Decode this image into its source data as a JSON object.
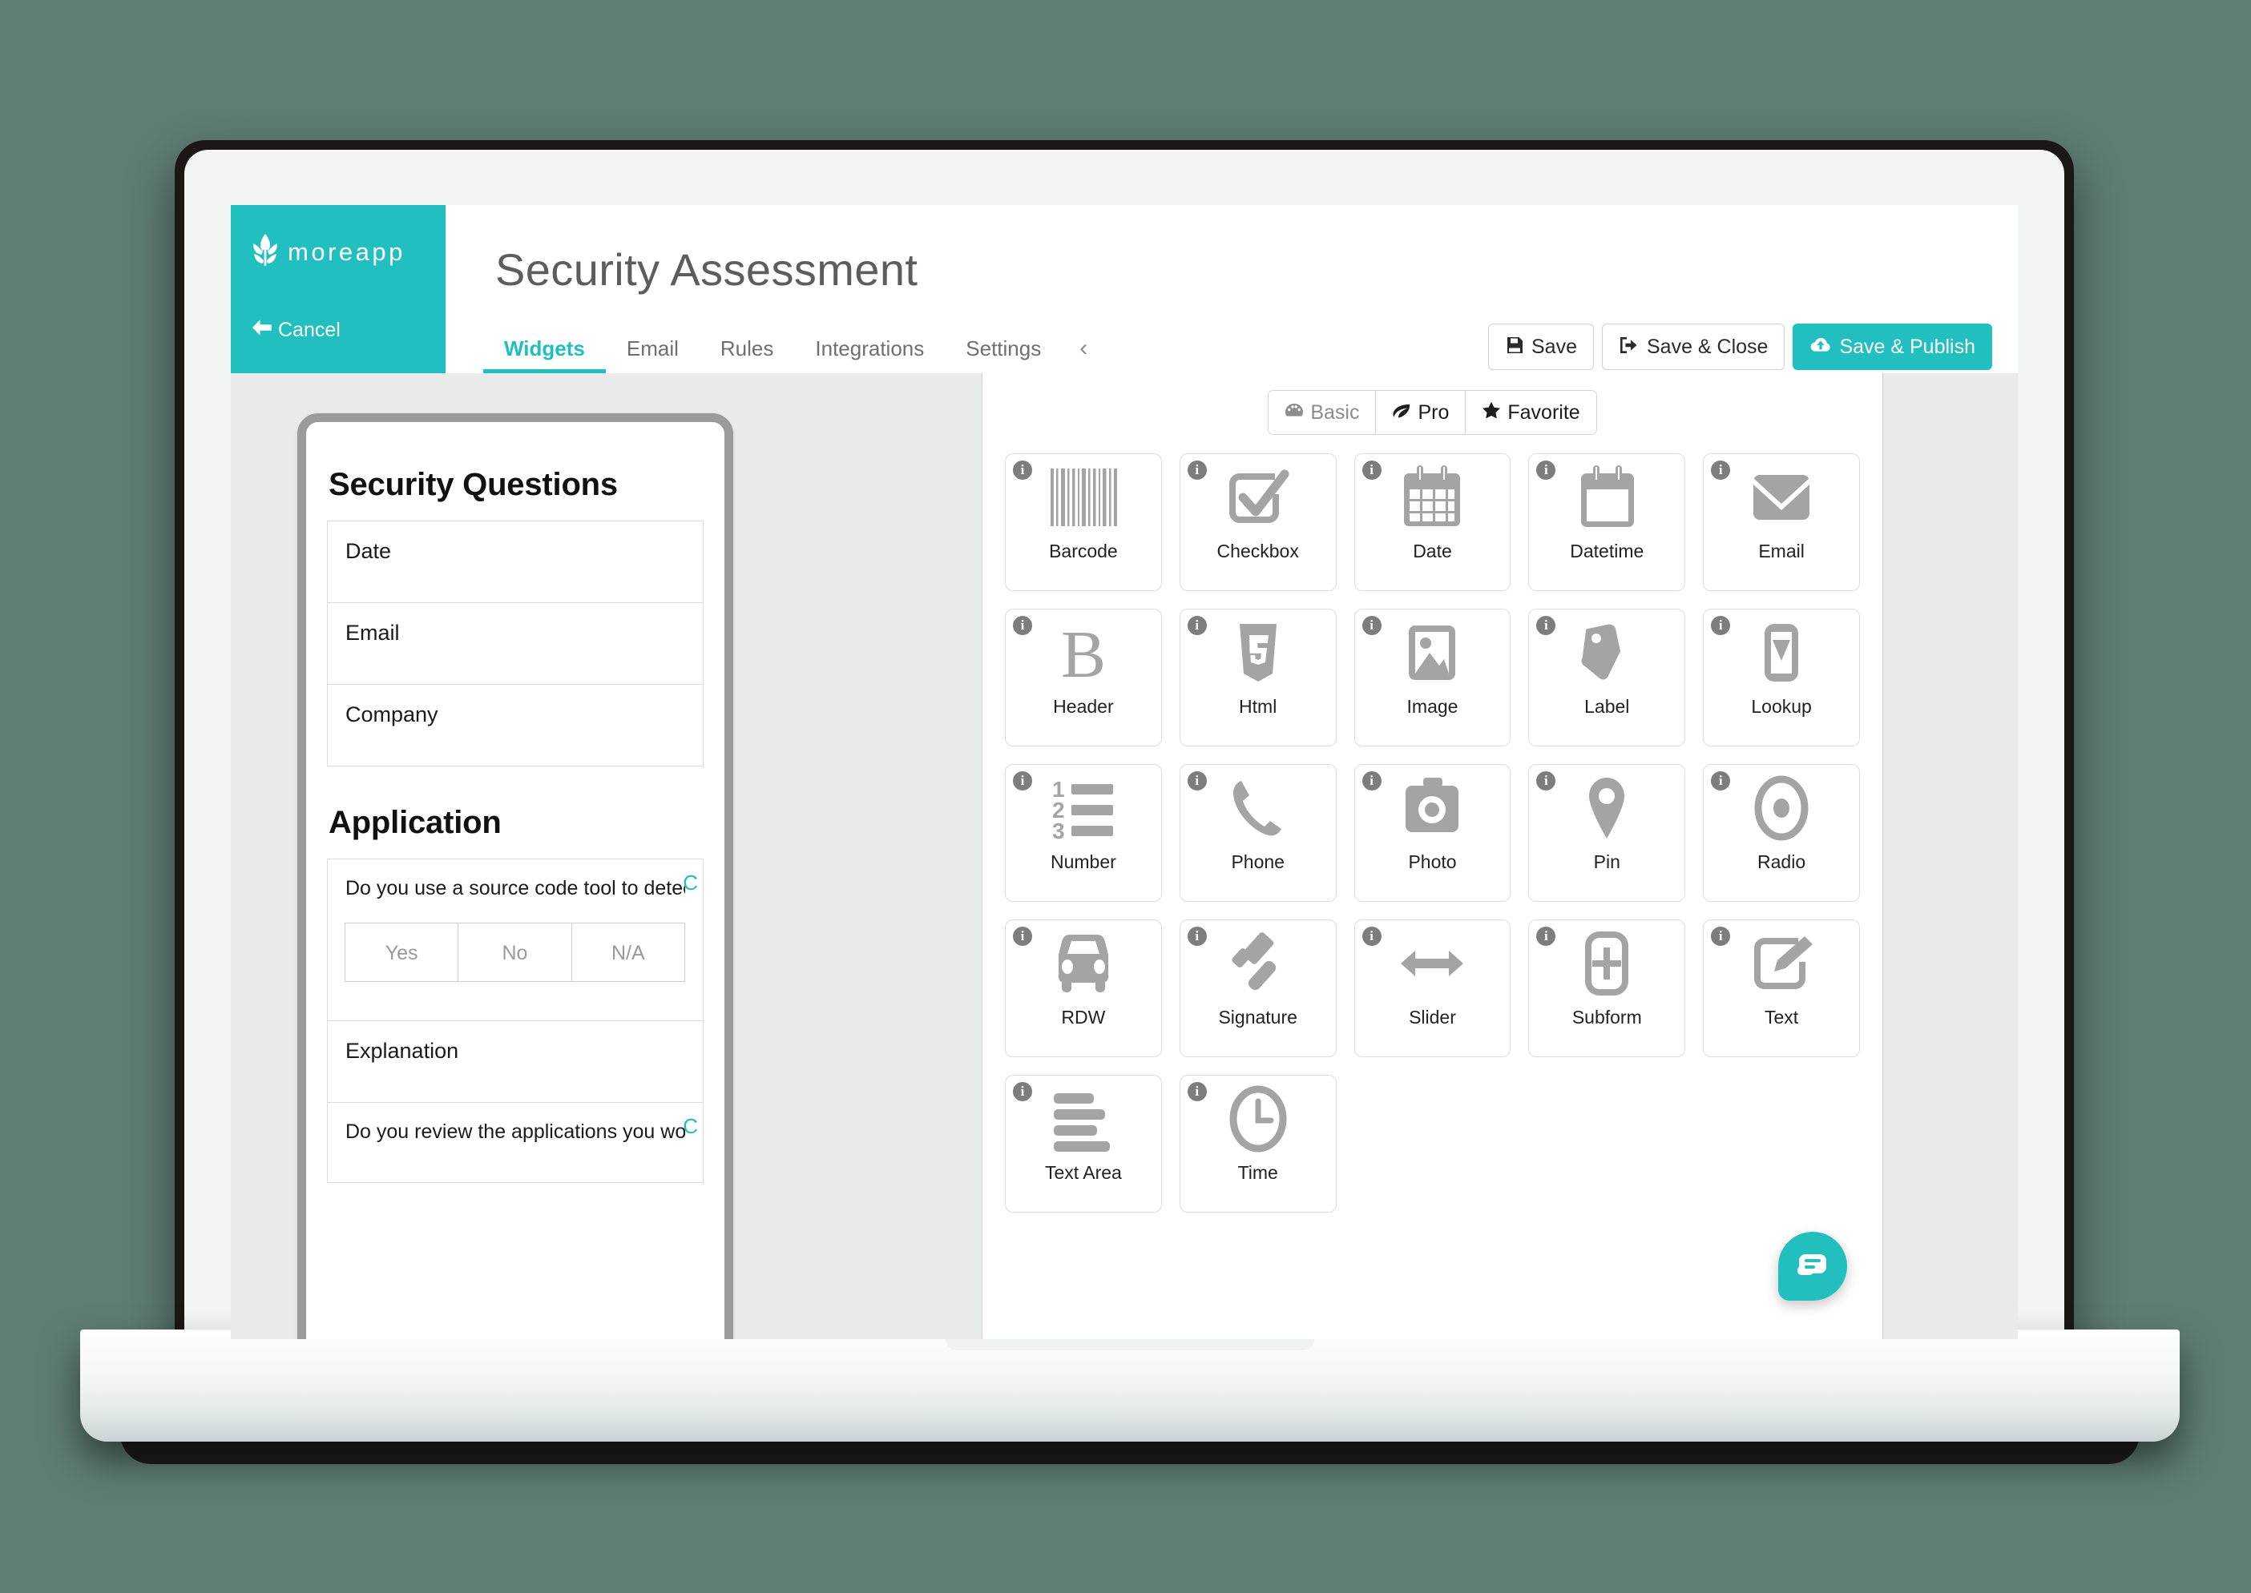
{
  "brand": {
    "name": "moreapp",
    "logo_icon": "wheat-leaf-icon",
    "accent_color": "#21bfbf",
    "cancel_label": "Cancel",
    "cancel_icon": "arrow-left-icon"
  },
  "header": {
    "title": "Security Assessment"
  },
  "tabs": [
    {
      "label": "Widgets",
      "active": true
    },
    {
      "label": "Email",
      "active": false
    },
    {
      "label": "Rules",
      "active": false
    },
    {
      "label": "Integrations",
      "active": false
    },
    {
      "label": "Settings",
      "active": false
    },
    {
      "label": "‹",
      "active": false,
      "icon": "chevron-left-icon"
    }
  ],
  "actions": [
    {
      "label": "Save",
      "icon": "floppy-disk-icon",
      "primary": false
    },
    {
      "label": "Save & Close",
      "icon": "sign-out-icon",
      "primary": false
    },
    {
      "label": "Save & Publish",
      "icon": "cloud-upload-icon",
      "primary": true
    }
  ],
  "preview": {
    "sections": [
      {
        "heading": "Security Questions"
      },
      {
        "heading": "Application"
      }
    ],
    "fields": [
      {
        "label": "Date"
      },
      {
        "label": "Email"
      },
      {
        "label": "Company"
      }
    ],
    "question_1": "Do you use a source code tool to detect defects in the co",
    "question_1_mark": "C",
    "yesno_options": [
      "Yes",
      "No",
      "N/A"
    ],
    "explanation_label": "Explanation",
    "question_2": "Do you review the applications you work with on securit",
    "question_2_mark": "C"
  },
  "filters": [
    {
      "label": "Basic",
      "icon": "dashboard-icon",
      "selected": true
    },
    {
      "label": "Pro",
      "icon": "leaf-icon",
      "selected": false
    },
    {
      "label": "Favorite",
      "icon": "star-icon",
      "selected": false
    }
  ],
  "widgets": [
    {
      "label": "Barcode",
      "icon": "barcode-icon"
    },
    {
      "label": "Checkbox",
      "icon": "checkbox-icon"
    },
    {
      "label": "Date",
      "icon": "calendar-icon"
    },
    {
      "label": "Datetime",
      "icon": "calendar-blank-icon"
    },
    {
      "label": "Email",
      "icon": "envelope-icon"
    },
    {
      "label": "Header",
      "icon": "bold-b-icon"
    },
    {
      "label": "Html",
      "icon": "html5-shield-icon"
    },
    {
      "label": "Image",
      "icon": "picture-icon"
    },
    {
      "label": "Label",
      "icon": "tag-icon"
    },
    {
      "label": "Lookup",
      "icon": "dropdown-icon"
    },
    {
      "label": "Number",
      "icon": "ordered-list-icon"
    },
    {
      "label": "Phone",
      "icon": "phone-icon"
    },
    {
      "label": "Photo",
      "icon": "camera-icon"
    },
    {
      "label": "Pin",
      "icon": "map-pin-icon"
    },
    {
      "label": "Radio",
      "icon": "radio-button-icon"
    },
    {
      "label": "RDW",
      "icon": "car-icon"
    },
    {
      "label": "Signature",
      "icon": "gavel-icon"
    },
    {
      "label": "Slider",
      "icon": "arrows-horizontal-icon"
    },
    {
      "label": "Subform",
      "icon": "plus-square-icon"
    },
    {
      "label": "Text",
      "icon": "pencil-square-icon"
    },
    {
      "label": "Text Area",
      "icon": "text-lines-icon"
    },
    {
      "label": "Time",
      "icon": "clock-icon"
    }
  ],
  "info_badge": "i",
  "chat": {
    "icon": "chat-bubble-icon"
  }
}
